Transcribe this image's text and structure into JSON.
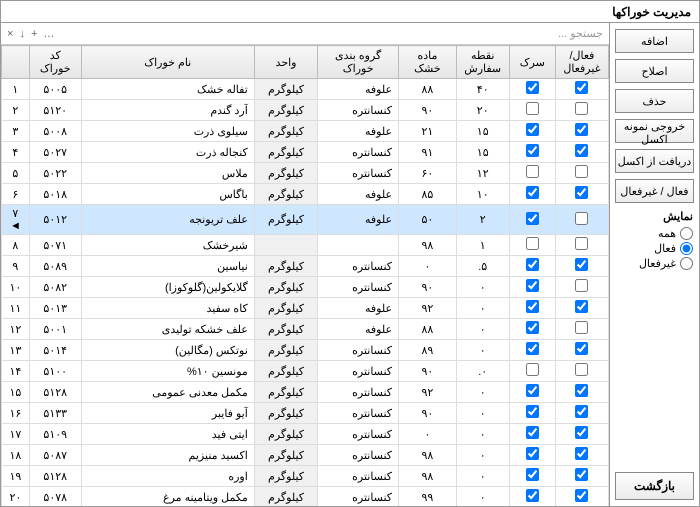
{
  "window": {
    "title": "مدیریت خوراکها"
  },
  "sidebar": {
    "add": "اضافه",
    "edit": "اصلاح",
    "delete": "حذف",
    "export_excel": "خروجی نمونه اکسل",
    "import_excel": "دریافت از اکسل",
    "toggle_active": "فعال / غیرفعال",
    "filter_title": "نمایش",
    "filter_all": "همه",
    "filter_active": "فعال",
    "filter_inactive": "غیرفعال",
    "back": "بازگشت"
  },
  "toolbar": {
    "search_placeholder": "جستجو ...",
    "icons": [
      "×",
      "↓",
      "+",
      "…"
    ]
  },
  "columns": {
    "active": "فعال/غیرفعال",
    "sarak": "سرک",
    "noghte": "نقطه سفارش",
    "made": "ماده خشک",
    "group": "گروه بندی خوراک",
    "unit": "واحد",
    "name": "نام خوراک",
    "code": "کد خوراک",
    "row": ""
  },
  "rows": [
    {
      "row": "۱",
      "code": "۵۰۰۵",
      "name": "تفاله خشک",
      "unit": "کیلوگرم",
      "group": "علوفه",
      "made": "۸۸",
      "noghte": "۴۰",
      "sarak": true,
      "active": true,
      "selected": false
    },
    {
      "row": "۲",
      "code": "۵۱۲۰",
      "name": "آرد گندم",
      "unit": "کیلوگرم",
      "group": "کنسانتره",
      "made": "۹۰",
      "noghte": "۲۰",
      "sarak": false,
      "active": false,
      "selected": false
    },
    {
      "row": "۳",
      "code": "۵۰۰۸",
      "name": "سیلوی ذرت",
      "unit": "کیلوگرم",
      "group": "علوفه",
      "made": "۲۱",
      "noghte": "۱۵",
      "sarak": true,
      "active": true,
      "selected": false
    },
    {
      "row": "۴",
      "code": "۵۰۲۷",
      "name": "کنجاله ذرت",
      "unit": "کیلوگرم",
      "group": "کنسانتره",
      "made": "۹۱",
      "noghte": "۱۵",
      "sarak": true,
      "active": true,
      "selected": false
    },
    {
      "row": "۵",
      "code": "۵۰۲۲",
      "name": "ملاس",
      "unit": "کیلوگرم",
      "group": "کنسانتره",
      "made": "۶۰",
      "noghte": "۱۲",
      "sarak": false,
      "active": false,
      "selected": false
    },
    {
      "row": "۶",
      "code": "۵۰۱۸",
      "name": "باگاس",
      "unit": "کیلوگرم",
      "group": "علوفه",
      "made": "۸۵",
      "noghte": "۱۰",
      "sarak": true,
      "active": true,
      "selected": false
    },
    {
      "row": "۷ ◄",
      "code": "۵۰۱۲",
      "name": "علف تریونجه",
      "unit": "کیلوگرم",
      "group": "علوفه",
      "made": "۵۰",
      "noghte": "۲",
      "sarak": true,
      "active": false,
      "selected": true
    },
    {
      "row": "۸",
      "code": "۵۰۷۱",
      "name": "شیرخشک",
      "unit": "",
      "group": "",
      "made": "۹۸",
      "noghte": "۱",
      "sarak": false,
      "active": false,
      "selected": false
    },
    {
      "row": "۹",
      "code": "۵۰۸۹",
      "name": "نیاسین",
      "unit": "کیلوگرم",
      "group": "کنسانتره",
      "made": "۰",
      "noghte": "۵.",
      "sarak": true,
      "active": true,
      "selected": false
    },
    {
      "row": "۱۰",
      "code": "۵۰۸۲",
      "name": "گلایکولین(گلوکوزا)",
      "unit": "کیلوگرم",
      "group": "کنسانتره",
      "made": "۹۰",
      "noghte": "۰",
      "sarak": true,
      "active": false,
      "selected": false
    },
    {
      "row": "۱۱",
      "code": "۵۰۱۳",
      "name": "کاه سفید",
      "unit": "کیلوگرم",
      "group": "علوفه",
      "made": "۹۲",
      "noghte": "۰",
      "sarak": true,
      "active": true,
      "selected": false
    },
    {
      "row": "۱۲",
      "code": "۵۰۰۱",
      "name": "علف خشکه تولیدی",
      "unit": "کیلوگرم",
      "group": "علوفه",
      "made": "۸۸",
      "noghte": "۰",
      "sarak": true,
      "active": false,
      "selected": false
    },
    {
      "row": "۱۳",
      "code": "۵۰۱۴",
      "name": "نوتکس (مگالین)",
      "unit": "کیلوگرم",
      "group": "کنسانتره",
      "made": "۸۹",
      "noghte": "۰",
      "sarak": true,
      "active": true,
      "selected": false
    },
    {
      "row": "۱۴",
      "code": "۵۱۰۰",
      "name": "مونسین ۱۰%",
      "unit": "کیلوگرم",
      "group": "کنسانتره",
      "made": "۹۰",
      "noghte": "۰.",
      "sarak": false,
      "active": false,
      "selected": false
    },
    {
      "row": "۱۵",
      "code": "۵۱۲۸",
      "name": "مکمل معدنی عمومی",
      "unit": "کیلوگرم",
      "group": "کنسانتره",
      "made": "۹۲",
      "noghte": "۰",
      "sarak": true,
      "active": true,
      "selected": false
    },
    {
      "row": "۱۶",
      "code": "۵۱۳۳",
      "name": "آیو فایبر",
      "unit": "کیلوگرم",
      "group": "کنسانتره",
      "made": "۹۰",
      "noghte": "۰",
      "sarak": true,
      "active": true,
      "selected": false
    },
    {
      "row": "۱۷",
      "code": "۵۱۰۹",
      "name": "ایتی فید",
      "unit": "کیلوگرم",
      "group": "کنسانتره",
      "made": "۰",
      "noghte": "۰",
      "sarak": true,
      "active": true,
      "selected": false
    },
    {
      "row": "۱۸",
      "code": "۵۰۸۷",
      "name": "اکسید منیزیم",
      "unit": "کیلوگرم",
      "group": "کنسانتره",
      "made": "۹۸",
      "noghte": "۰",
      "sarak": true,
      "active": true,
      "selected": false
    },
    {
      "row": "۱۹",
      "code": "۵۱۲۸",
      "name": "اوره",
      "unit": "کیلوگرم",
      "group": "کنسانتره",
      "made": "۹۸",
      "noghte": "۰",
      "sarak": true,
      "active": true,
      "selected": false
    },
    {
      "row": "۲۰",
      "code": "۵۰۷۸",
      "name": "مکمل ویتامینه مرغ",
      "unit": "کیلوگرم",
      "group": "کنسانتره",
      "made": "۹۹",
      "noghte": "۰",
      "sarak": true,
      "active": true,
      "selected": false
    }
  ]
}
